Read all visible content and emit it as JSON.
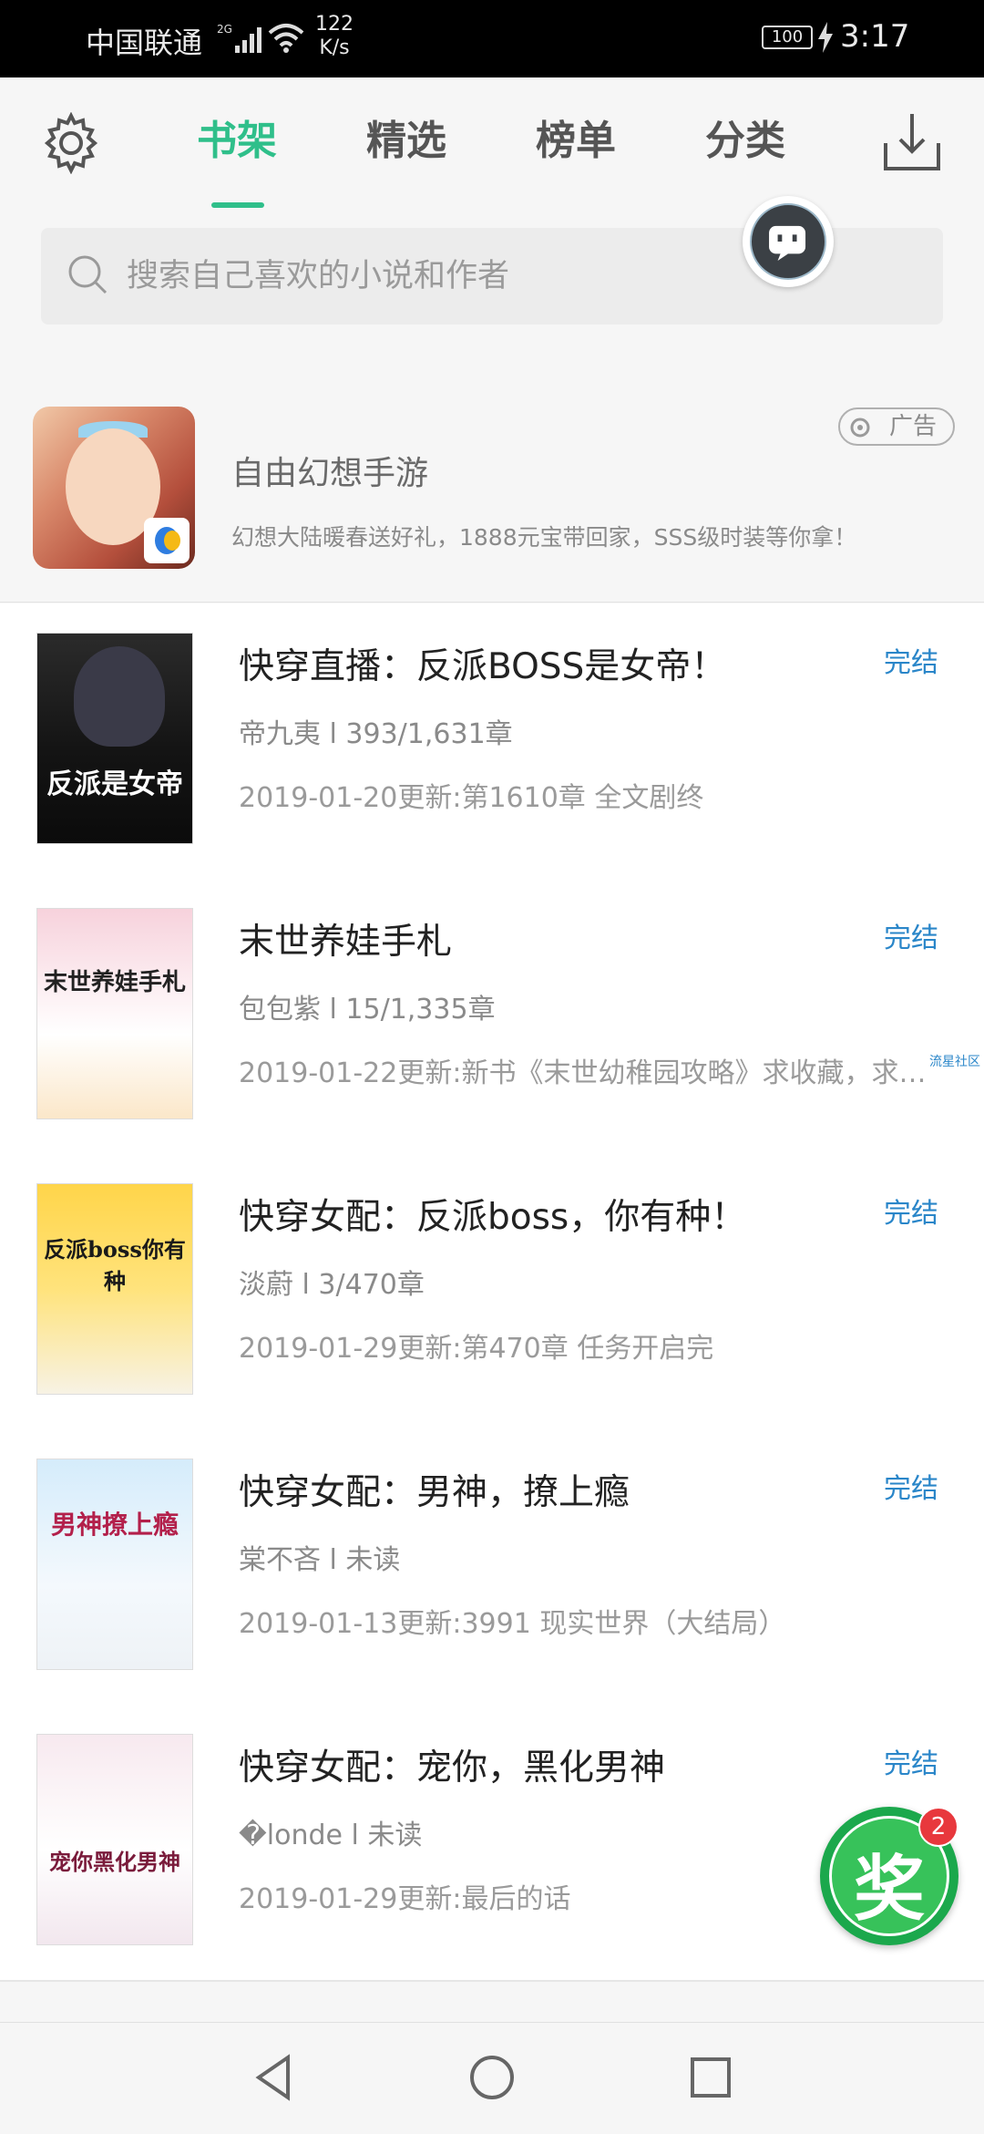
{
  "status_bar": {
    "carrier": "中国联通",
    "network_type": "2G",
    "net_speed_value": "122",
    "net_speed_unit": "K/s",
    "battery": "100",
    "time": "3:17"
  },
  "header": {
    "tabs": [
      {
        "label": "书架",
        "active": true
      },
      {
        "label": "精选",
        "active": false
      },
      {
        "label": "榜单",
        "active": false
      },
      {
        "label": "分类",
        "active": false
      }
    ]
  },
  "search": {
    "placeholder": "搜索自己喜欢的小说和作者"
  },
  "ad": {
    "title": "自由幻想手游",
    "description": "幻想大陆暖春送好礼，1888元宝带回家，SSS级时装等你拿！",
    "badge": "广告"
  },
  "books": [
    {
      "title": "快穿直播：反派BOSS是女帝！",
      "status": "完结",
      "meta": "帝九夷 l 393/1,631章",
      "update": "2019-01-20更新:第1610章 全文剧终",
      "cover_text": "反派是女帝"
    },
    {
      "title": "末世养娃手札",
      "status": "完结",
      "meta": "包包紫 l 15/1,335章",
      "update": "2019-01-22更新:新书《末世幼稚园攻略》求收藏，求推...",
      "cover_text": "末世养娃手札",
      "side_link": "流星社区"
    },
    {
      "title": "快穿女配：反派boss，你有种！",
      "status": "完结",
      "meta": "淡蔚 l 3/470章",
      "update": "2019-01-29更新:第470章 任务开启完",
      "cover_text": "反派boss你有种"
    },
    {
      "title": "快穿女配：男神，撩上瘾",
      "status": "完结",
      "meta": "棠不吝 l 未读",
      "update": "2019-01-13更新:3991 现实世界（大结局）",
      "cover_text": "男神撩上瘾"
    },
    {
      "title": "快穿女配：宠你，黑化男神",
      "status": "完结",
      "meta": "�londe l 未读",
      "update": "2019-01-29更新:最后的话",
      "cover_text": "宠你黑化男神"
    }
  ],
  "reward": {
    "label": "奖",
    "count": "2"
  },
  "colors": {
    "accent": "#2fbf8a",
    "status_blue": "#2a86c9"
  }
}
